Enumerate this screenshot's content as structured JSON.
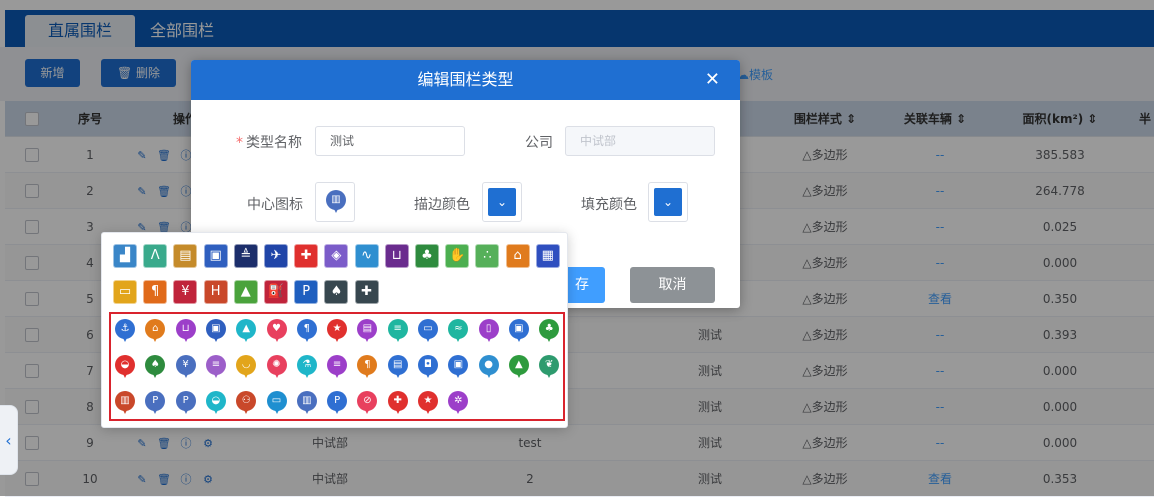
{
  "tabs": [
    {
      "label": "直属围栏"
    },
    {
      "label": "全部围栏"
    }
  ],
  "toolbar": {
    "add_label": "新增",
    "delete_label": "删除",
    "template_label": "模板"
  },
  "table": {
    "columns": [
      "序号",
      "操作",
      "围栏样式",
      "关联车辆",
      "面积(km²)",
      "半"
    ],
    "rows": [
      {
        "idx": "1",
        "company": "",
        "name": "",
        "type": "",
        "style": "多边形",
        "vehicles": "--",
        "area": "385.583"
      },
      {
        "idx": "2",
        "company": "",
        "name": "",
        "type": "",
        "style": "多边形",
        "vehicles": "--",
        "area": "264.778"
      },
      {
        "idx": "3",
        "company": "",
        "name": "",
        "type": "",
        "style": "多边形",
        "vehicles": "--",
        "area": "0.025"
      },
      {
        "idx": "4",
        "company": "",
        "name": "",
        "type": "",
        "style": "多边形",
        "vehicles": "--",
        "area": "0.000"
      },
      {
        "idx": "5",
        "company": "",
        "name": "",
        "type": "",
        "style": "多边形",
        "vehicles": "查看",
        "area": "0.350"
      },
      {
        "idx": "6",
        "company": "",
        "name": "",
        "type": "测试",
        "style": "多边形",
        "vehicles": "--",
        "area": "0.393"
      },
      {
        "idx": "7",
        "company": "",
        "name": "",
        "type": "测试",
        "style": "多边形",
        "vehicles": "--",
        "area": "0.000"
      },
      {
        "idx": "8",
        "company": "",
        "name": "",
        "type": "测试",
        "style": "多边形",
        "vehicles": "--",
        "area": "0.000"
      },
      {
        "idx": "9",
        "company": "中试部",
        "name": "test",
        "type": "测试",
        "style": "多边形",
        "vehicles": "--",
        "area": "0.000"
      },
      {
        "idx": "10",
        "company": "中试部",
        "name": "2",
        "type": "测试",
        "style": "多边形",
        "vehicles": "查看",
        "area": "0.353"
      }
    ]
  },
  "dialog": {
    "title": "编辑围栏类型",
    "close_icon": "close-icon",
    "type_name_label": "类型名称",
    "type_name_value": "测试",
    "company_label": "公司",
    "company_value": "中试部",
    "center_icon_label": "中心图标",
    "stroke_color_label": "描边颜色",
    "fill_color_label": "填充颜色",
    "save_label": "存",
    "cancel_label": "取消"
  },
  "icon_picker": {
    "square_icons": [
      {
        "name": "factory-icon",
        "color": "#3a86c8",
        "glyph": "▟"
      },
      {
        "name": "road-icon",
        "color": "#3aaa8c",
        "glyph": "Λ"
      },
      {
        "name": "warehouse-icon",
        "color": "#c58b2a",
        "glyph": "▤"
      },
      {
        "name": "truck-icon",
        "color": "#2f5fbf",
        "glyph": "▣"
      },
      {
        "name": "ship-icon",
        "color": "#1c2e6b",
        "glyph": "≜"
      },
      {
        "name": "airplane-icon",
        "color": "#2045a8",
        "glyph": "✈"
      },
      {
        "name": "hospital-cross-icon",
        "color": "#e0302e",
        "glyph": "✚"
      },
      {
        "name": "box-icon",
        "color": "#7b5cc9",
        "glyph": "◈"
      },
      {
        "name": "route-icon",
        "color": "#2f8fd0",
        "glyph": "∿"
      },
      {
        "name": "cart-icon",
        "color": "#6a2c8e",
        "glyph": "⊔"
      },
      {
        "name": "tree-icon",
        "color": "#2e8b3e",
        "glyph": "♣"
      },
      {
        "name": "hand-icon",
        "color": "#4caf50",
        "glyph": "✋"
      },
      {
        "name": "footprint-icon",
        "color": "#56b05a",
        "glyph": "∴"
      },
      {
        "name": "home-icon",
        "color": "#e07b1d",
        "glyph": "⌂"
      },
      {
        "name": "building-icon",
        "color": "#2f4fbf",
        "glyph": "▦"
      },
      {
        "name": "bus-icon",
        "color": "#e2a51b",
        "glyph": "▭"
      },
      {
        "name": "restaurant-icon",
        "color": "#e06a1a",
        "glyph": "¶"
      },
      {
        "name": "yuan-icon",
        "color": "#c0243b",
        "glyph": "¥"
      },
      {
        "name": "hotel-icon",
        "color": "#c9482a",
        "glyph": "H"
      },
      {
        "name": "mountain-icon",
        "color": "#4aa33c",
        "glyph": "▲"
      },
      {
        "name": "gas-station-icon",
        "color": "#c0243b",
        "glyph": "⛽"
      },
      {
        "name": "parking-icon",
        "color": "#1f5fbf",
        "glyph": "P"
      },
      {
        "name": "park-tree-icon",
        "color": "#37474f",
        "glyph": "♠"
      },
      {
        "name": "puzzle-icon",
        "color": "#37474f",
        "glyph": "✚"
      }
    ],
    "pin_icons": [
      {
        "name": "anchor-pin-icon",
        "color": "#2f6fd2",
        "glyph": "⚓"
      },
      {
        "name": "house-pin-icon",
        "color": "#e07b1d",
        "glyph": "⌂"
      },
      {
        "name": "cart-pin-icon",
        "color": "#9c3fc9",
        "glyph": "⊔"
      },
      {
        "name": "id-pin-icon",
        "color": "#2f5fbf",
        "glyph": "▣"
      },
      {
        "name": "graduation-pin-icon",
        "color": "#1fb6c9",
        "glyph": "▲"
      },
      {
        "name": "heart-pin-icon",
        "color": "#e8405e",
        "glyph": "♥"
      },
      {
        "name": "food-pin-icon",
        "color": "#2f6fd2",
        "glyph": "¶"
      },
      {
        "name": "police-pin-icon",
        "color": "#e0302e",
        "glyph": "★"
      },
      {
        "name": "bag-pin-icon",
        "color": "#9c3fc9",
        "glyph": "▤"
      },
      {
        "name": "bed-pin-icon",
        "color": "#1fb6a0",
        "glyph": "≡"
      },
      {
        "name": "bus-pin-icon",
        "color": "#2f6fd2",
        "glyph": "▭"
      },
      {
        "name": "ship-pin-icon",
        "color": "#1fb6a0",
        "glyph": "≈"
      },
      {
        "name": "phone-pin-icon",
        "color": "#9c3fc9",
        "glyph": "▯"
      },
      {
        "name": "fuel-pin-icon",
        "color": "#2f6fd2",
        "glyph": "▣"
      },
      {
        "name": "tree-pin-icon",
        "color": "#2e9b3e",
        "glyph": "♣"
      },
      {
        "name": "bowl-pin-icon",
        "color": "#e0302e",
        "glyph": "◒"
      },
      {
        "name": "pine-pin-icon",
        "color": "#2e8b3e",
        "glyph": "♠"
      },
      {
        "name": "yuan-pin-icon",
        "color": "#4a6fbf",
        "glyph": "¥"
      },
      {
        "name": "sleep-pin-icon",
        "color": "#9c5fc9",
        "glyph": "≡"
      },
      {
        "name": "cup-pin-icon",
        "color": "#e2a51b",
        "glyph": "◡"
      },
      {
        "name": "atom-pin-icon",
        "color": "#e8405e",
        "glyph": "✺"
      },
      {
        "name": "flask-pin-icon",
        "color": "#1fb6c9",
        "glyph": "⚗"
      },
      {
        "name": "burger-pin-icon",
        "color": "#9c3fc9",
        "glyph": "≡"
      },
      {
        "name": "cutlery-pin-icon",
        "color": "#e07b1d",
        "glyph": "¶"
      },
      {
        "name": "doc-pin-icon",
        "color": "#2f6fd2",
        "glyph": "▤"
      },
      {
        "name": "car-pin-icon",
        "color": "#2f6fd2",
        "glyph": "◘"
      },
      {
        "name": "gas-pin-icon",
        "color": "#2f6fd2",
        "glyph": "▣"
      },
      {
        "name": "dot-pin-icon",
        "color": "#2f8fd0",
        "glyph": "●"
      },
      {
        "name": "mountain-pin-icon",
        "color": "#2e9b3e",
        "glyph": "▲"
      },
      {
        "name": "leaf-pin-icon",
        "color": "#2e9b6e",
        "glyph": "❦"
      },
      {
        "name": "bank-pin-icon",
        "color": "#c9482a",
        "glyph": "▥"
      },
      {
        "name": "parking-pin-icon",
        "color": "#4a6fbf",
        "glyph": "P"
      },
      {
        "name": "parking2-pin-icon",
        "color": "#4a6fbf",
        "glyph": "P"
      },
      {
        "name": "drop-pin-icon",
        "color": "#1fb6c9",
        "glyph": "◒"
      },
      {
        "name": "group-pin-icon",
        "color": "#c9482a",
        "glyph": "⚇"
      },
      {
        "name": "truck-pin-icon",
        "color": "#1f8fd0",
        "glyph": "▭"
      },
      {
        "name": "tower-pin-icon",
        "color": "#4a6fbf",
        "glyph": "▥"
      },
      {
        "name": "p-pin-icon",
        "color": "#2f6fd2",
        "glyph": "P"
      },
      {
        "name": "pill-pin-icon",
        "color": "#e8405e",
        "glyph": "⊘"
      },
      {
        "name": "plus-pin-icon",
        "color": "#e0302e",
        "glyph": "✚"
      },
      {
        "name": "star-pin-icon",
        "color": "#e0302e",
        "glyph": "★"
      },
      {
        "name": "film-pin-icon",
        "color": "#9c3fc9",
        "glyph": "✲"
      }
    ]
  },
  "selected_center_icon": "building-pin-icon",
  "colors": {
    "primary": "#1f6fd2",
    "header": "#0a5ab8",
    "highlight": "#d9232d"
  }
}
